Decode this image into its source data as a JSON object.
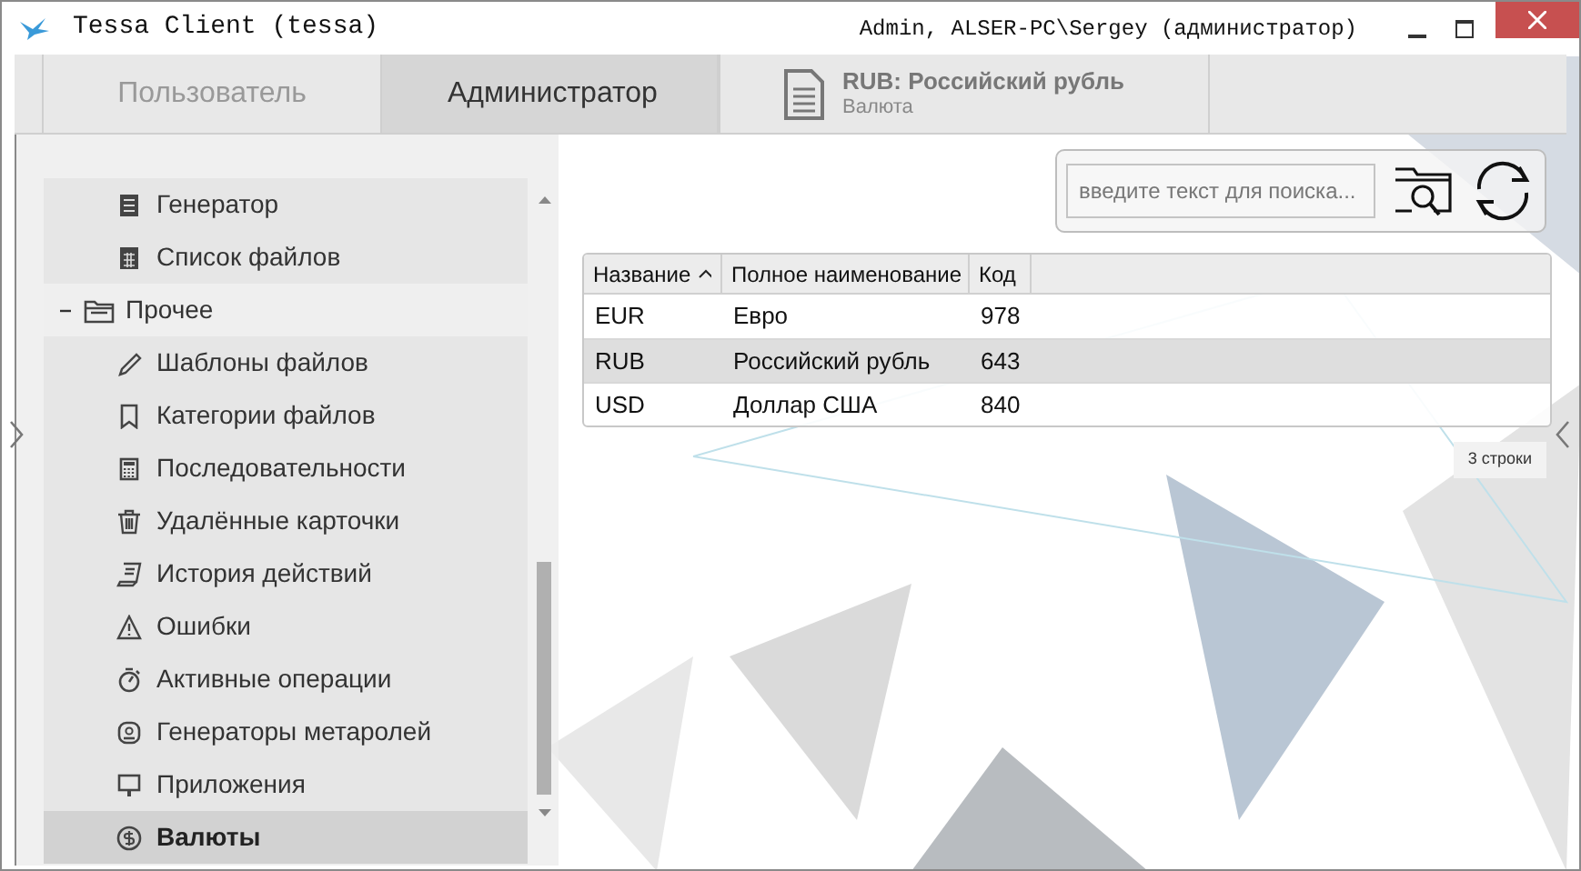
{
  "window": {
    "title": "Tessa Client (tessa)",
    "user": "Admin, ALSER-PC\\Sergey (администратор)"
  },
  "tabs": [
    {
      "label": "Пользователь",
      "selected": false
    },
    {
      "label": "Администратор",
      "selected": true
    }
  ],
  "card_tab": {
    "title": "RUB: Российский рубль",
    "subtitle": "Валюта"
  },
  "sidebar": {
    "groups": [
      {
        "items": [
          {
            "label": "Генератор",
            "selected": false
          },
          {
            "label": "Список файлов",
            "selected": false
          }
        ]
      },
      {
        "label": "Прочее",
        "expanded": true,
        "children": [
          {
            "label": "Шаблоны файлов",
            "selected": false
          },
          {
            "label": "Категории файлов",
            "selected": false
          },
          {
            "label": "Последовательности",
            "selected": false
          },
          {
            "label": "Удалённые карточки",
            "selected": false
          },
          {
            "label": "История действий",
            "selected": false
          },
          {
            "label": "Ошибки",
            "selected": false
          },
          {
            "label": "Активные операции",
            "selected": false
          },
          {
            "label": "Генераторы метаролей",
            "selected": false
          },
          {
            "label": "Приложения",
            "selected": false
          },
          {
            "label": "Валюты",
            "selected": true
          }
        ]
      }
    ]
  },
  "search": {
    "placeholder": "введите текст для поиска..."
  },
  "table": {
    "columns": [
      {
        "label": "Название",
        "sorted": true
      },
      {
        "label": "Полное наименование",
        "sorted": false
      },
      {
        "label": "Код",
        "sorted": false
      }
    ],
    "rows": [
      {
        "cells": [
          "EUR",
          "Евро",
          "978"
        ],
        "selected": false
      },
      {
        "cells": [
          "RUB",
          "Российский рубль",
          "643"
        ],
        "selected": true
      },
      {
        "cells": [
          "USD",
          "Доллар США",
          "840"
        ],
        "selected": false
      }
    ]
  },
  "row_count": "3 строки"
}
